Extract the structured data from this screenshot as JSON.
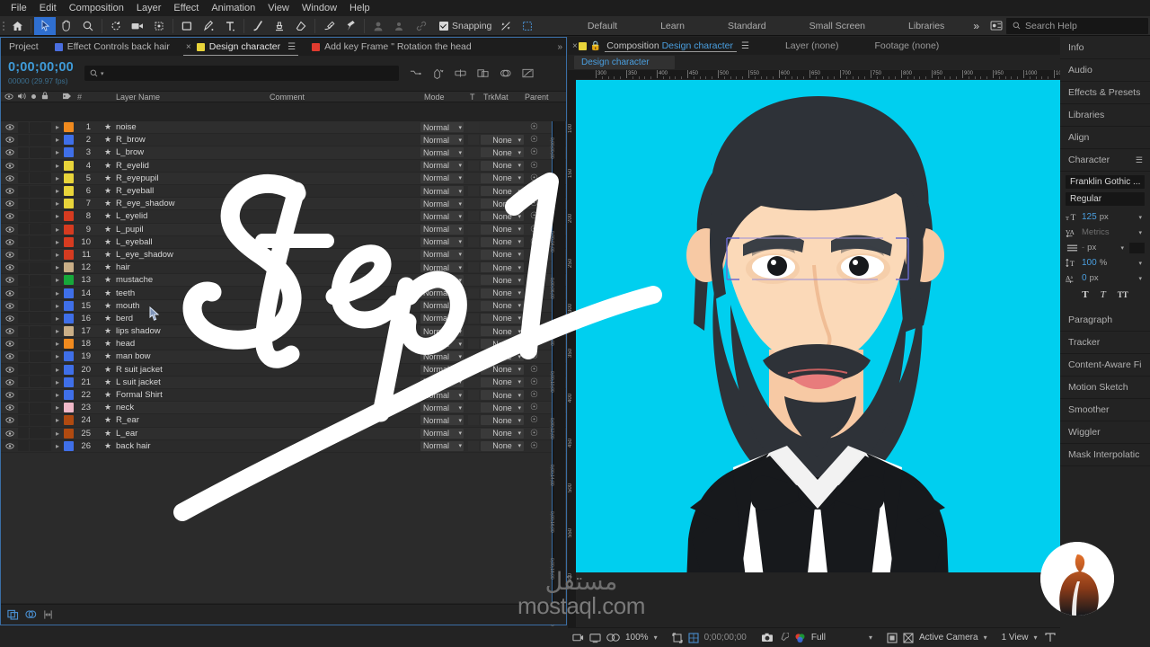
{
  "menu": {
    "items": [
      "File",
      "Edit",
      "Composition",
      "Layer",
      "Effect",
      "Animation",
      "View",
      "Window",
      "Help"
    ]
  },
  "toolbar": {
    "icons": [
      "home-icon",
      "selection-tool-icon",
      "hand-tool-icon",
      "zoom-tool-icon",
      "rotation-tool-icon",
      "camera-tool-icon",
      "anchor-point-tool-icon",
      "shape-tool-icon",
      "pen-tool-icon",
      "type-tool-icon",
      "brush-tool-icon",
      "clone-stamp-tool-icon",
      "eraser-tool-icon",
      "roto-brush-tool-icon",
      "puppet-pin-tool-icon",
      "mask-icon",
      "face-track-icon",
      "link-icon"
    ],
    "snapping_label": "Snapping",
    "workspaces": [
      "Default",
      "Learn",
      "Standard",
      "Small Screen",
      "Libraries"
    ],
    "more_label": "»",
    "search_help_placeholder": "Search Help"
  },
  "timeline": {
    "tabs": [
      {
        "label": "Project",
        "swatch": "",
        "active": false,
        "closable": false
      },
      {
        "label": "Effect Controls back hair",
        "swatch": "#4a6ee0",
        "active": false,
        "closable": false
      },
      {
        "label": "Design character",
        "swatch": "#e8d43a",
        "active": true,
        "closable": true
      },
      {
        "label": "Add key Frame \" Rotation the head",
        "swatch": "#e03b2f",
        "active": false,
        "closable": false
      }
    ],
    "timecode": "0;00;00;00",
    "frames": "00000 (29.97 fps)",
    "search_placeholder": "",
    "columns": [
      "Layer Name",
      "Comment",
      "Mode",
      "T",
      "TrkMat",
      "Parent"
    ],
    "header_icons": [
      "shy-icon",
      "collapse-transforms-icon",
      "quality-icon",
      "effects-icon",
      "frame-blend-icon",
      "motion-blur-icon",
      "graph-editor-icon"
    ],
    "layers": [
      {
        "num": "1",
        "name": "noise",
        "color": "#f08a1e",
        "mode": "Normal",
        "trkmat": ""
      },
      {
        "num": "2",
        "name": "R_brow",
        "color": "#3f6fe8",
        "mode": "Normal",
        "trkmat": "None"
      },
      {
        "num": "3",
        "name": "L_brow",
        "color": "#3f6fe8",
        "mode": "Normal",
        "trkmat": "None"
      },
      {
        "num": "4",
        "name": "R_eyelid",
        "color": "#e8d43a",
        "mode": "Normal",
        "trkmat": "None"
      },
      {
        "num": "5",
        "name": "R_eyepupil",
        "color": "#e8d43a",
        "mode": "Normal",
        "trkmat": "None"
      },
      {
        "num": "6",
        "name": "R_eyeball",
        "color": "#e8d43a",
        "mode": "Normal",
        "trkmat": "None"
      },
      {
        "num": "7",
        "name": "R_eye_shadow",
        "color": "#e8d43a",
        "mode": "Normal",
        "trkmat": "None"
      },
      {
        "num": "8",
        "name": "L_eyelid",
        "color": "#d63b20",
        "mode": "Normal",
        "trkmat": "None"
      },
      {
        "num": "9",
        "name": "L_pupil",
        "color": "#d63b20",
        "mode": "Normal",
        "trkmat": "None"
      },
      {
        "num": "10",
        "name": "L_eyeball",
        "color": "#d63b20",
        "mode": "Normal",
        "trkmat": "None"
      },
      {
        "num": "11",
        "name": "L_eye_shadow",
        "color": "#d63b20",
        "mode": "Normal",
        "trkmat": "None"
      },
      {
        "num": "12",
        "name": "hair",
        "color": "#c9ae87",
        "mode": "Normal",
        "trkmat": "None"
      },
      {
        "num": "13",
        "name": "mustache",
        "color": "#17a83a",
        "mode": "Normal",
        "trkmat": "None"
      },
      {
        "num": "14",
        "name": "teeth",
        "color": "#3f6fe8",
        "mode": "Normal",
        "trkmat": "None"
      },
      {
        "num": "15",
        "name": "mouth",
        "color": "#3f6fe8",
        "mode": "Normal",
        "trkmat": "None"
      },
      {
        "num": "16",
        "name": "berd",
        "color": "#3f6fe8",
        "mode": "Normal",
        "trkmat": "None"
      },
      {
        "num": "17",
        "name": "lips shadow",
        "color": "#c9ae87",
        "mode": "Normal",
        "trkmat": "None"
      },
      {
        "num": "18",
        "name": "head",
        "color": "#f08a1e",
        "mode": "Normal",
        "trkmat": "None"
      },
      {
        "num": "19",
        "name": "man bow",
        "color": "#3f6fe8",
        "mode": "Normal",
        "trkmat": "None"
      },
      {
        "num": "20",
        "name": "R suit jacket",
        "color": "#3f6fe8",
        "mode": "Normal",
        "trkmat": "None"
      },
      {
        "num": "21",
        "name": "L suit jacket",
        "color": "#3f6fe8",
        "mode": "Normal",
        "trkmat": "None"
      },
      {
        "num": "22",
        "name": "Formal Shirt",
        "color": "#3f6fe8",
        "mode": "Normal",
        "trkmat": "None"
      },
      {
        "num": "23",
        "name": "neck",
        "color": "#f0b8c8",
        "mode": "Normal",
        "trkmat": "None"
      },
      {
        "num": "24",
        "name": "R_ear",
        "color": "#b04a10",
        "mode": "Normal",
        "trkmat": "None"
      },
      {
        "num": "25",
        "name": "L_ear",
        "color": "#b04a10",
        "mode": "Normal",
        "trkmat": "None"
      },
      {
        "num": "26",
        "name": "back hair",
        "color": "#3f6fe8",
        "mode": "Normal",
        "trkmat": "None"
      }
    ],
    "bottom_icons": [
      "toggle-switches-icon",
      "toggle-modes-icon",
      "frame-stretch-icon"
    ]
  },
  "composition": {
    "tab_prefix": "Composition",
    "tab_name": "Design character",
    "layer_tab": "Layer  (none)",
    "footage_tab": "Footage  (none)",
    "breadcrumb": "Design character",
    "ruler_ticks": [
      "300",
      "350",
      "400",
      "450",
      "500",
      "550",
      "600",
      "650",
      "700",
      "750",
      "800",
      "850",
      "900",
      "950",
      "1000",
      "10"
    ],
    "bg_color": "#00cfef",
    "bottom": {
      "zoom": "100%",
      "timecode": "0;00;00;00",
      "resolution": "Full",
      "camera": "Active Camera",
      "views": "1 View",
      "icons": [
        "always-preview-icon",
        "toggle-transparency-icon",
        "toggle-mask-icon",
        "region-of-interest-icon",
        "snapshot-icon",
        "show-snapshot-icon",
        "channel-icon",
        "toggle-alpha-icon",
        "toggle-guides-icon",
        "timeline-icon",
        "comp-flow-icon"
      ]
    }
  },
  "dock": {
    "panels": [
      "Info",
      "Audio",
      "Effects & Presets",
      "Libraries",
      "Align"
    ],
    "character": {
      "title": "Character",
      "font_family": "Franklin Gothic ...",
      "font_style": "Regular",
      "size_value": "125",
      "size_unit": "px",
      "kerning_value": "Metrics",
      "leading_value": "-",
      "leading_unit": "px",
      "vscale_value": "100",
      "vscale_unit": "%",
      "baseline_value": "0",
      "baseline_unit": "px",
      "styles": [
        "T",
        "T",
        "TT"
      ]
    },
    "panels_bottom": [
      "Paragraph",
      "Tracker",
      "Content-Aware Fi",
      "Motion Sketch",
      "Smoother",
      "Wiggler",
      "Mask Interpolatic"
    ]
  },
  "overlay": {
    "step_text": "Step 1",
    "watermark_ar": "مستقل",
    "watermark_latin": "mostaql.com"
  }
}
